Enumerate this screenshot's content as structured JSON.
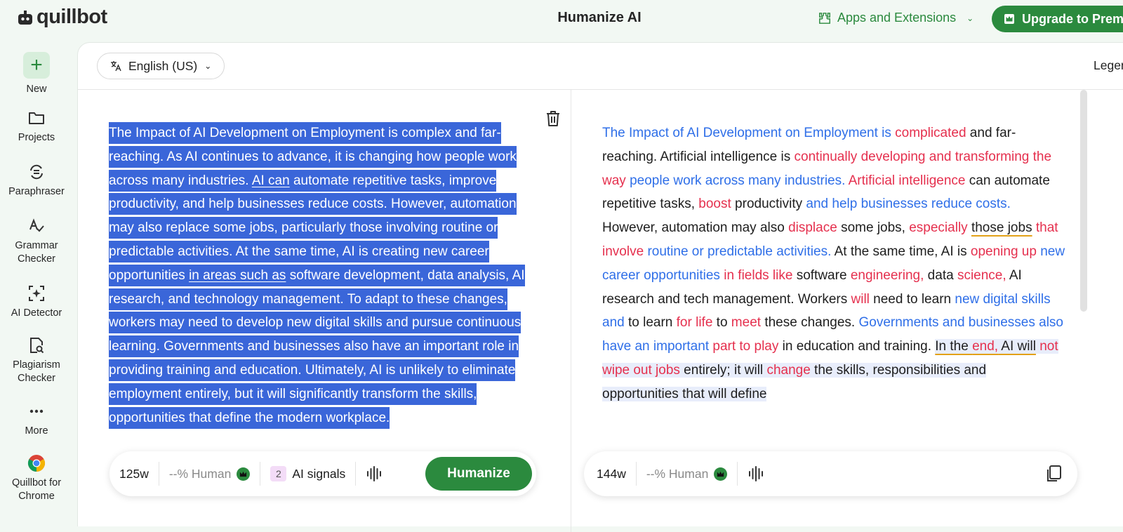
{
  "header": {
    "logo_text": "quillbot",
    "title": "Humanize AI",
    "apps_label": "Apps and Extensions",
    "upgrade_label": "Upgrade to Premium"
  },
  "sidebar": {
    "items": [
      {
        "label": "New",
        "icon": "plus-icon"
      },
      {
        "label": "Projects",
        "icon": "folder-icon"
      },
      {
        "label": "Paraphraser",
        "icon": "paraphraser-icon"
      },
      {
        "label": "Grammar Checker",
        "icon": "grammar-icon"
      },
      {
        "label": "AI Detector",
        "icon": "ai-detector-icon"
      },
      {
        "label": "Plagiarism Checker",
        "icon": "plagiarism-icon"
      },
      {
        "label": "More",
        "icon": "more-icon"
      },
      {
        "label": "Quillbot for Chrome",
        "icon": "chrome-icon"
      }
    ]
  },
  "toolbar": {
    "language": "English (US)",
    "legend_label": "Legend"
  },
  "input": {
    "p1": "The Impact of AI Development on Employment is complex and far-reaching. As AI continues to advance, it is changing how people work across many industries. ",
    "u1": "AI can",
    "p2": " automate repetitive tasks, improve productivity, and help businesses reduce costs. However, automation may also replace some jobs, particularly those involving routine or predictable activities. At the same time, AI is creating new career opportunities ",
    "u2": "in areas such as",
    "p3": " software development, data analysis, AI research, and technology management. To adapt to these changes, workers may need to develop new digital skills and pursue continuous learning. Governments and businesses also have an important role in providing training and education. Ultimately, AI is unlikely to eliminate employment entirely, but it will significantly transform the skills, opportunities that define the modern workplace.",
    "word_count": "125w",
    "human_score": "--% Human",
    "signals_count": "2",
    "signals_label": "AI signals",
    "humanize_label": "Humanize"
  },
  "output": {
    "segments": [
      {
        "t": "The Impact of AI Development on Employment is ",
        "c": "b"
      },
      {
        "t": "complicated",
        "c": "r"
      },
      {
        "t": " and far-reaching. Artificial intelligence is ",
        "c": ""
      },
      {
        "t": "continually developing and transforming the way",
        "c": "r"
      },
      {
        "t": " ",
        "c": ""
      },
      {
        "t": "people work across many industries.",
        "c": "b"
      },
      {
        "t": " ",
        "c": ""
      },
      {
        "t": "Artificial intelligence",
        "c": "r"
      },
      {
        "t": " can automate repetitive tasks, ",
        "c": ""
      },
      {
        "t": "boost",
        "c": "r"
      },
      {
        "t": " productivity ",
        "c": ""
      },
      {
        "t": "and help businesses reduce costs.",
        "c": "b"
      },
      {
        "t": " However, automation may also ",
        "c": ""
      },
      {
        "t": "displace",
        "c": "r"
      },
      {
        "t": " some jobs, ",
        "c": ""
      },
      {
        "t": "especially",
        "c": "r"
      },
      {
        "t": " ",
        "c": ""
      },
      {
        "t": "those jobs",
        "c": "uo"
      },
      {
        "t": " ",
        "c": ""
      },
      {
        "t": "that involve",
        "c": "r"
      },
      {
        "t": " ",
        "c": ""
      },
      {
        "t": "routine or predictable activities.",
        "c": "b"
      },
      {
        "t": " At the same time, AI is ",
        "c": ""
      },
      {
        "t": "opening up",
        "c": "r"
      },
      {
        "t": " ",
        "c": ""
      },
      {
        "t": "new career opportunities",
        "c": "b"
      },
      {
        "t": " ",
        "c": ""
      },
      {
        "t": "in fields like",
        "c": "r"
      },
      {
        "t": " software ",
        "c": ""
      },
      {
        "t": "engineering,",
        "c": "r"
      },
      {
        "t": " data ",
        "c": ""
      },
      {
        "t": "science,",
        "c": "r"
      },
      {
        "t": " AI research and tech management. Workers ",
        "c": ""
      },
      {
        "t": "will",
        "c": "r"
      },
      {
        "t": " need to learn ",
        "c": ""
      },
      {
        "t": "new digital skills and",
        "c": "b"
      },
      {
        "t": " to learn ",
        "c": ""
      },
      {
        "t": "for life",
        "c": "r"
      },
      {
        "t": " to ",
        "c": ""
      },
      {
        "t": "meet",
        "c": "r"
      },
      {
        "t": " these changes. ",
        "c": ""
      },
      {
        "t": "Governments and businesses also have an important",
        "c": "b"
      },
      {
        "t": " ",
        "c": ""
      },
      {
        "t": "part to play",
        "c": "r"
      },
      {
        "t": " in education and training. ",
        "c": ""
      },
      {
        "t": "In the ",
        "c": "hl uo"
      },
      {
        "t": "end,",
        "c": "hl uo r"
      },
      {
        "t": " AI will",
        "c": "hl uo"
      },
      {
        "t": " ",
        "c": "hl"
      },
      {
        "t": "not wipe out jobs",
        "c": "hl r"
      },
      {
        "t": " entirely; it will ",
        "c": "hl"
      },
      {
        "t": "change",
        "c": "hl r"
      },
      {
        "t": " the skills, responsibilities and opportunities that will define",
        "c": "hl"
      }
    ],
    "word_count": "144w",
    "human_score": "--% Human"
  }
}
